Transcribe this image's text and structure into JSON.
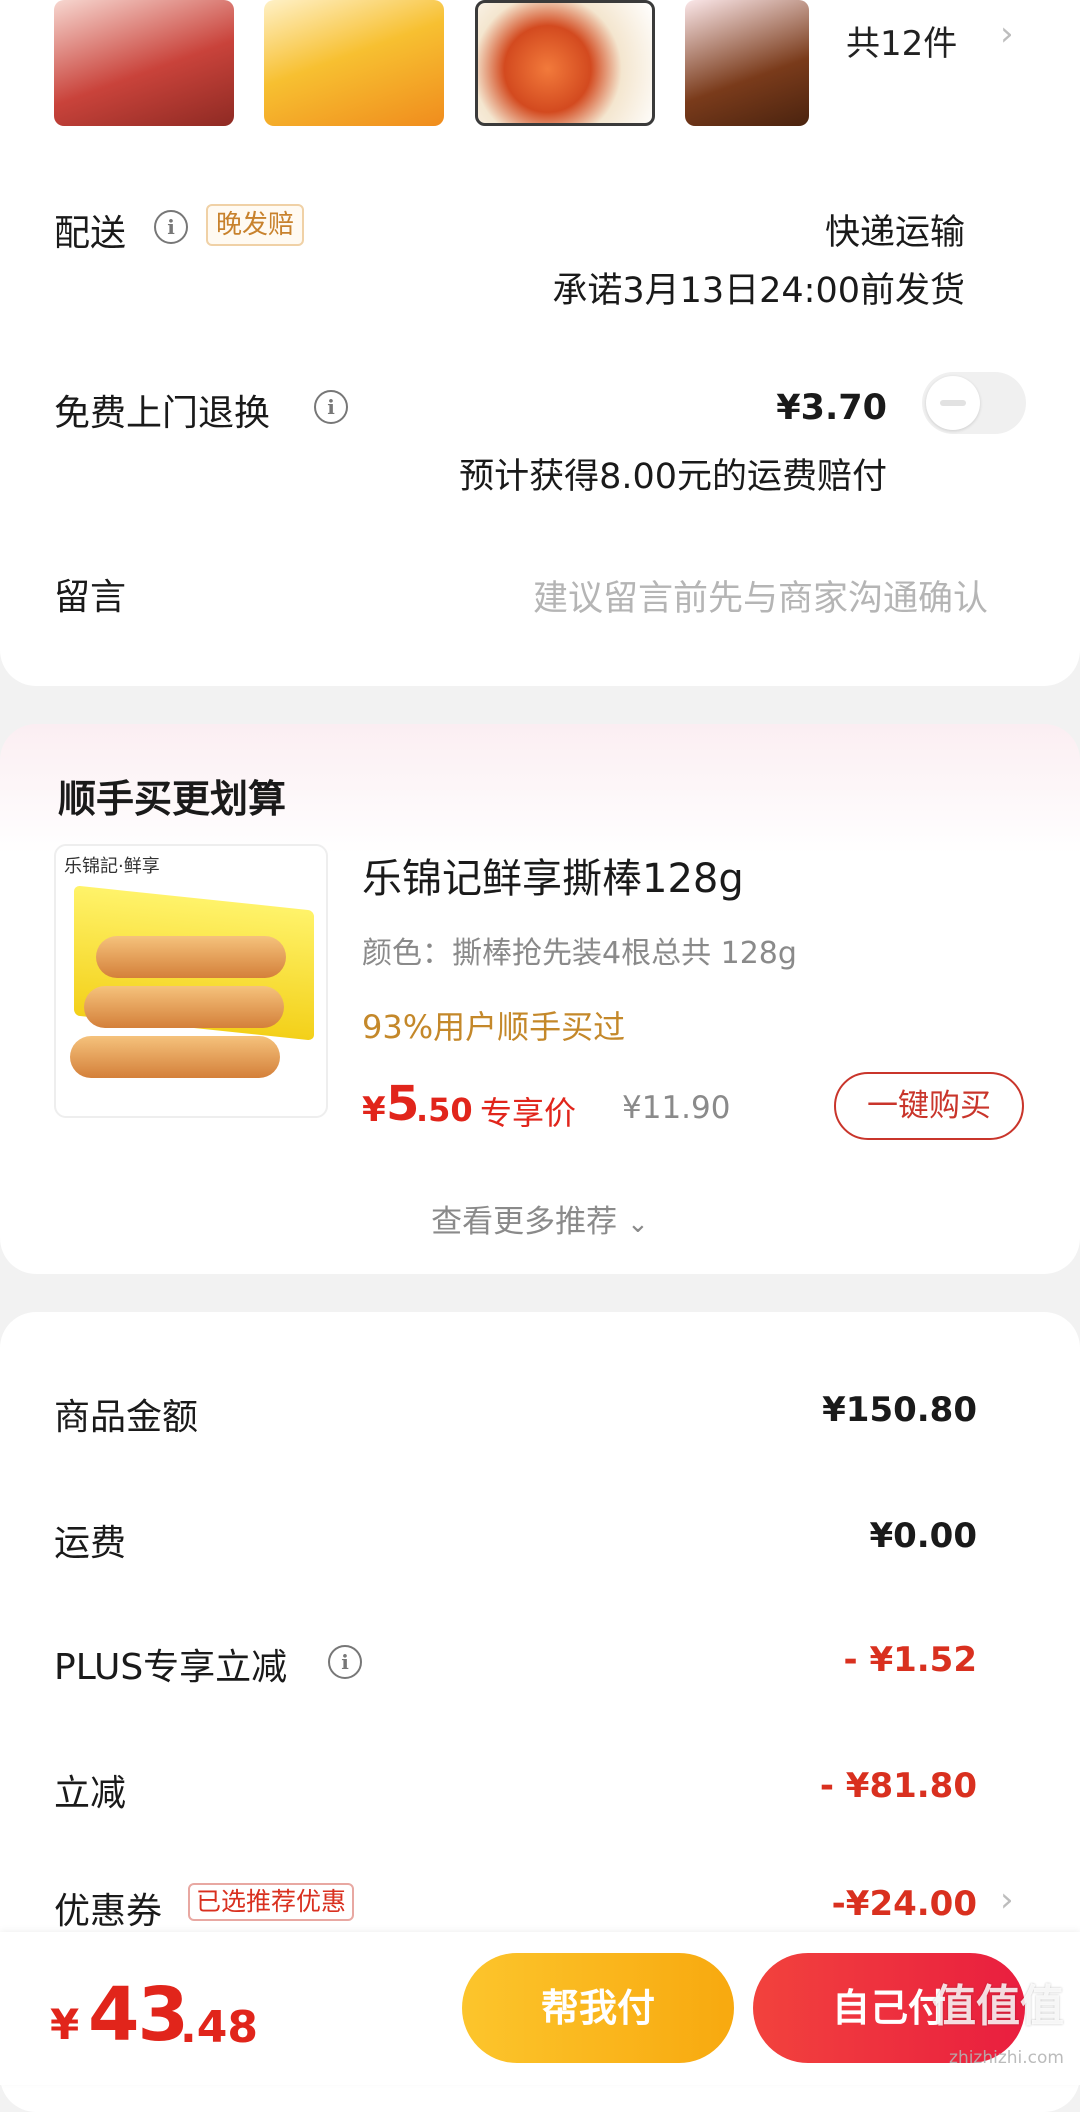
{
  "items": {
    "count_label": "共12件"
  },
  "delivery": {
    "label": "配送",
    "tag": "晚发赔",
    "method": "快递运输",
    "promise": "承诺3月13日24:00前发货"
  },
  "free_return": {
    "label": "免费上门退换",
    "price": "¥3.70",
    "toggle_on": false,
    "note": "预计获得8.00元的运费赔付"
  },
  "message": {
    "label": "留言",
    "placeholder": "建议留言前先与商家沟通确认"
  },
  "upsell": {
    "title": "顺手买更划算",
    "product": {
      "image_brand": "乐锦記·鲜享",
      "name": "乐锦记鲜享撕棒128g",
      "spec": "颜色：撕棒抢先装4根总共 128g",
      "bought": "93%用户顺手买过",
      "price_symbol": "¥",
      "price_int": "5",
      "price_dec": ".50",
      "price_tag": "专享价",
      "original_price": "¥11.90",
      "buy_label": "一键购买"
    },
    "more_label": "查看更多推荐"
  },
  "summary": {
    "rows": [
      {
        "label": "商品金额",
        "value": "¥150.80"
      },
      {
        "label": "运费",
        "value": "¥0.00"
      },
      {
        "label": "PLUS专享立减",
        "value": "- ¥1.52"
      },
      {
        "label": "立减",
        "value": "- ¥81.80"
      },
      {
        "label": "优惠券",
        "value": "-¥24.00"
      }
    ],
    "coupon_tag": "已选推荐优惠"
  },
  "bottom": {
    "total_symbol": "¥",
    "total_int": "43",
    "total_dec": ".48",
    "help_pay_label": "帮我付",
    "self_pay_label": "自己付",
    "watermark": "值值值",
    "watermark_url": "zhizhizhi.com"
  },
  "colors": {
    "accent_red": "#e1251b",
    "orange_tag": "#c8822d",
    "help_button": "#fcc52c",
    "self_button": "#f2423d"
  }
}
